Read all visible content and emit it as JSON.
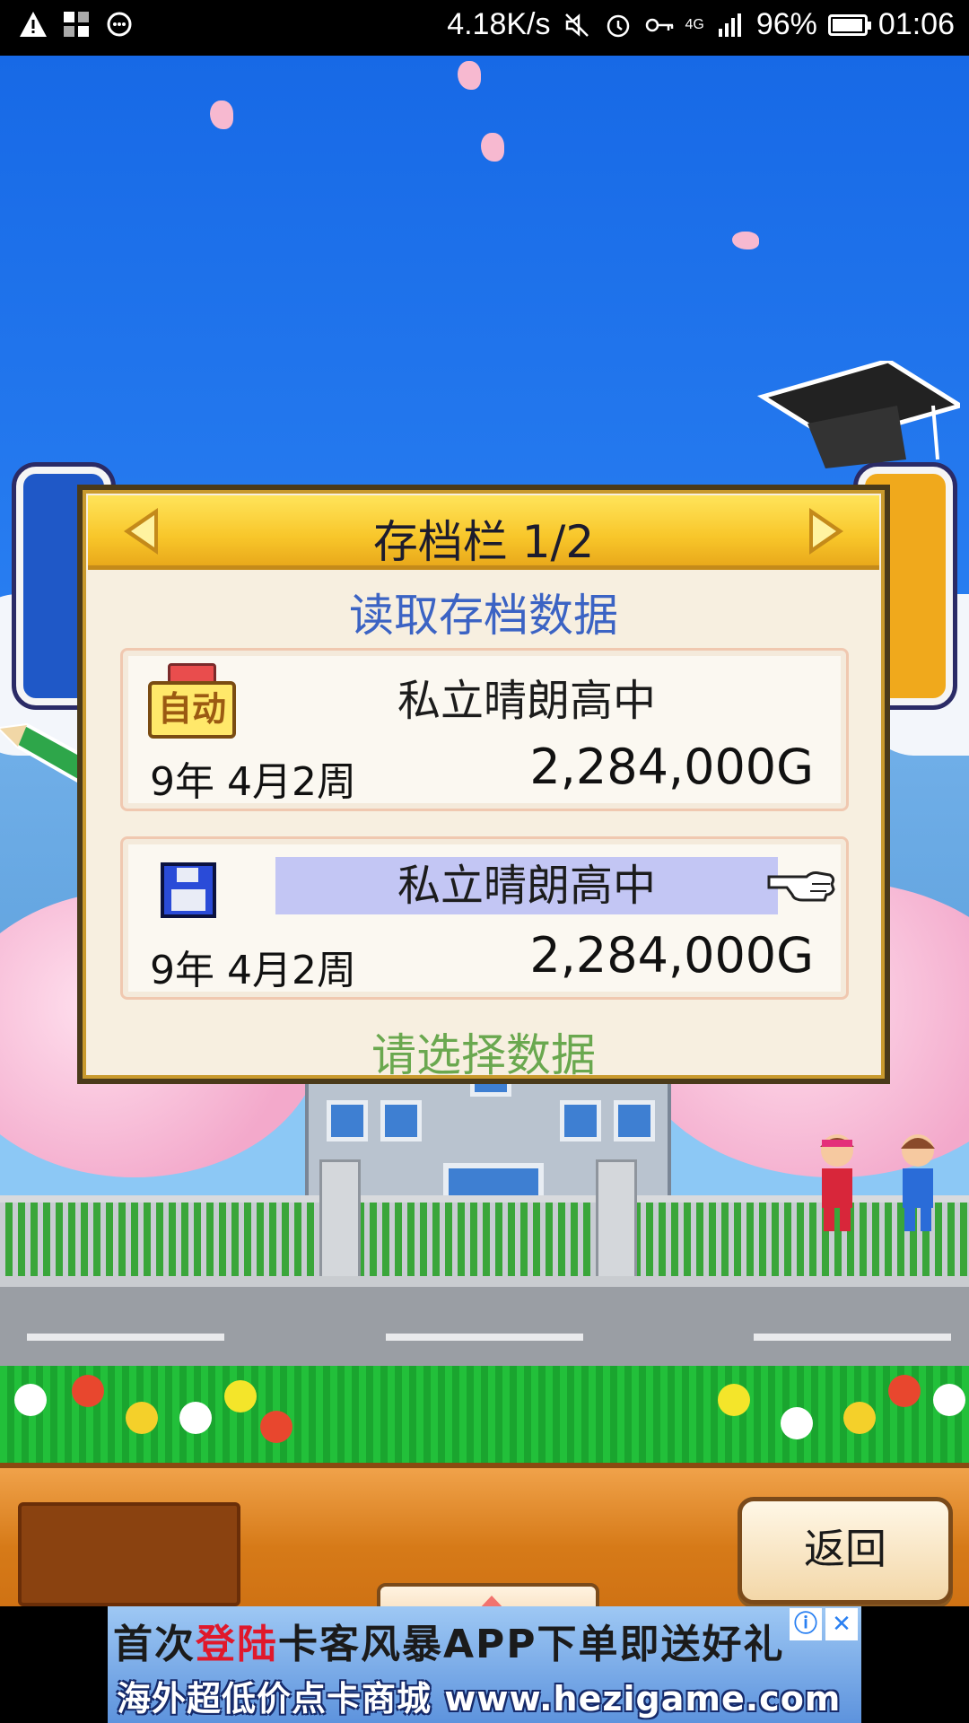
{
  "status_bar": {
    "network_speed": "4.18K/s",
    "signal_label": "4G",
    "battery": "96%",
    "battery_level": 0.96,
    "time": "01:06",
    "icons": [
      "warning-icon",
      "app-grid-icon",
      "chat-bubble-icon",
      "mute-icon",
      "alarm-icon",
      "key-icon",
      "signal-icon",
      "battery-icon"
    ]
  },
  "dialog": {
    "title": "存档栏  1/2",
    "subtitle": "读取存档数据",
    "slots": [
      {
        "type": "auto",
        "icon_label": "自动",
        "school": "私立晴朗高中",
        "date": "9年 4月2周",
        "money": "2,284,000G",
        "selected": false
      },
      {
        "type": "manual",
        "icon": "floppy-disk-icon",
        "school": "私立晴朗高中",
        "date": "9年 4月2周",
        "money": "2,284,000G",
        "selected": true
      }
    ],
    "footer": "请选择数据"
  },
  "bottom_panel": {
    "back_label": "返回",
    "up_icon": "up-triangle-icon"
  },
  "ad": {
    "line1_prefix": "首次",
    "line1_highlight": "登陆",
    "line1_rest": "卡客风暴APP下单即送好礼",
    "line2": "海外超低价点卡商城 www.hezigame.com",
    "info_icon": "ⓘ",
    "close_icon": "✕"
  },
  "colors": {
    "sky": "#1769e6",
    "header_gold": "#f8c62a",
    "subtitle_blue": "#3b63c4",
    "footer_green": "#6aa84f",
    "selected_highlight": "#c3c6f4",
    "panel_orange": "#d67a18"
  }
}
